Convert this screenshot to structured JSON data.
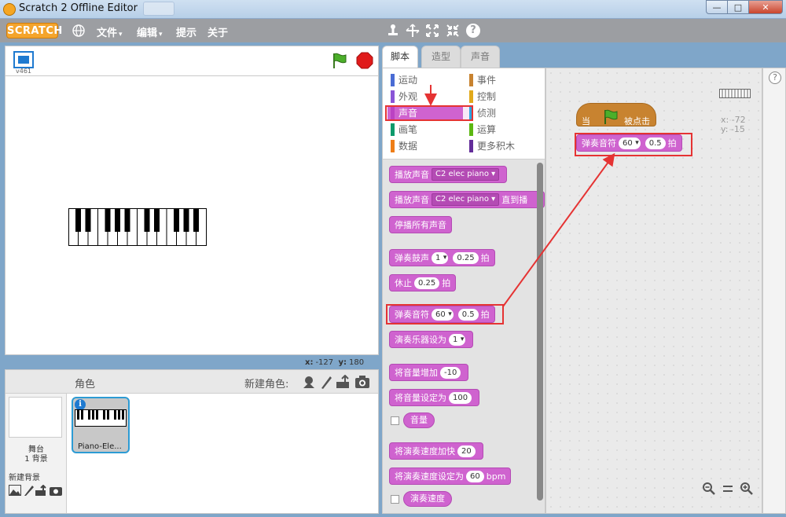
{
  "window": {
    "title": "Scratch 2 Offline Editor",
    "min": "—",
    "max": "□",
    "close": "✕"
  },
  "menubar": {
    "logo": "SCRATCH",
    "file": "文件",
    "edit": "编辑",
    "tips": "提示",
    "about": "关于",
    "caret": "▾",
    "tools": [
      "stamp-icon",
      "cut-icon",
      "grow-icon",
      "shrink-icon",
      "help-icon"
    ],
    "help_glyph": "?"
  },
  "stage": {
    "version": "v461",
    "coords": {
      "x_label": "x:",
      "x": "-127",
      "y_label": "y:",
      "y": "180"
    }
  },
  "sprites": {
    "title": "角色",
    "new_sprite": "新建角色:",
    "stage_name": "舞台",
    "backdrop_count": "1 背景",
    "new_backdrop": "新建背景",
    "sprite_name": "Piano-Ele...",
    "info": "i"
  },
  "tabs": [
    "脚本",
    "造型",
    "声音"
  ],
  "categories": {
    "left": [
      {
        "label": "运动",
        "color": "#4a6cd4"
      },
      {
        "label": "外观",
        "color": "#8a55d7"
      },
      {
        "label": "声音",
        "color": "#bb42c3"
      },
      {
        "label": "画笔",
        "color": "#0e9a6c"
      },
      {
        "label": "数据",
        "color": "#ee7d16"
      }
    ],
    "right": [
      {
        "label": "事件",
        "color": "#c88330"
      },
      {
        "label": "控制",
        "color": "#e1a91a"
      },
      {
        "label": "侦测",
        "color": "#2ca5e2"
      },
      {
        "label": "运算",
        "color": "#5cb712"
      },
      {
        "label": "更多积木",
        "color": "#632d99"
      }
    ]
  },
  "blocks": {
    "play_sound": {
      "label": "播放声音",
      "sound": "C2 elec piano"
    },
    "play_sound_until": {
      "label": "播放声音",
      "sound": "C2 elec piano",
      "suffix": "直到播"
    },
    "stop_all": "停播所有声音",
    "drum": {
      "label": "弹奏鼓声",
      "drum": "1",
      "beats": "0.25",
      "unit": "拍"
    },
    "rest": {
      "label": "休止",
      "beats": "0.25",
      "unit": "拍"
    },
    "note": {
      "label": "弹奏音符",
      "note": "60",
      "beats": "0.5",
      "unit": "拍"
    },
    "instrument": {
      "label": "演奏乐器设为",
      "value": "1"
    },
    "vol_change": {
      "label": "将音量增加",
      "value": "-10"
    },
    "vol_set": {
      "label": "将音量设定为",
      "value": "100"
    },
    "volume": "音量",
    "tempo_change": {
      "label": "将演奏速度加快",
      "value": "20"
    },
    "tempo_set": {
      "label": "将演奏速度设定为",
      "value": "60",
      "unit": "bpm"
    },
    "tempo": "演奏速度"
  },
  "script": {
    "hat_when": "当",
    "hat_clicked": "被点击",
    "note": {
      "label": "弹奏音符",
      "note": "60",
      "beats": "0.5",
      "unit": "拍"
    },
    "sprite_x": "x: -72",
    "sprite_y": "y: -15"
  },
  "zoom": [
    "zoom-out-icon",
    "zoom-reset-icon",
    "zoom-in-icon"
  ],
  "colors": {
    "sound": "#cf63cf",
    "events": "#c88330",
    "highlight": "#e53333"
  }
}
